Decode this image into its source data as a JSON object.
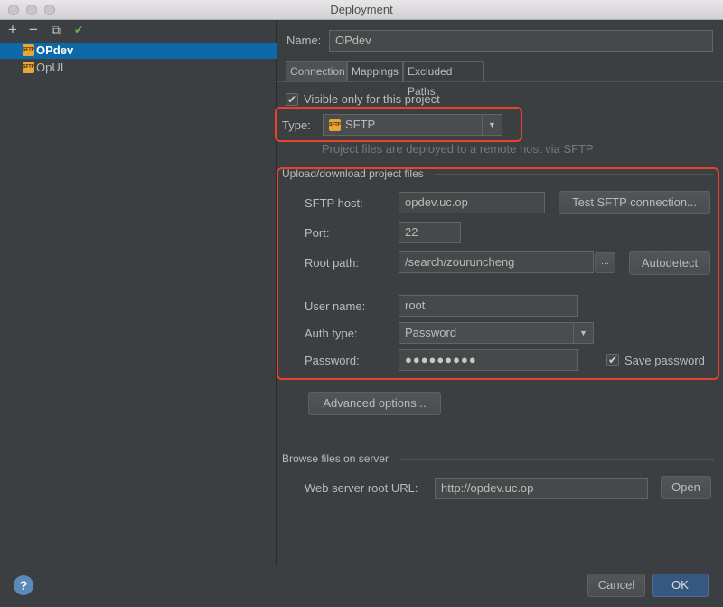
{
  "window": {
    "title": "Deployment"
  },
  "toolbar": {
    "add": "+",
    "remove": "−",
    "copy": "⧉",
    "default": "✔"
  },
  "servers": [
    {
      "name": "OPdev",
      "selected": true,
      "icon": "sftp-icon",
      "icon_text": "SFTP"
    },
    {
      "name": "OpUI",
      "selected": false,
      "icon": "sftp-icon",
      "icon_text": "SFTP"
    }
  ],
  "form": {
    "name_label": "Name:",
    "name_value": "OPdev",
    "tabs": [
      "Connection",
      "Mappings",
      "Excluded Paths"
    ],
    "visible_only": "Visible only for this project",
    "type_label": "Type:",
    "type_value": "SFTP",
    "type_hint": "Project files are deployed to a remote host via SFTP",
    "upload_section": "Upload/download project files",
    "sftp_host_label": "SFTP host:",
    "sftp_host_value": "opdev.uc.op",
    "test_button": "Test SFTP connection...",
    "port_label": "Port:",
    "port_value": "22",
    "root_path_label": "Root path:",
    "root_path_value": "/search/zouruncheng",
    "browse_button": "...",
    "autodetect_button": "Autodetect",
    "user_name_label": "User name:",
    "user_name_value": "root",
    "auth_type_label": "Auth type:",
    "auth_type_value": "Password",
    "password_label": "Password:",
    "password_value": "●●●●●●●●●",
    "save_password": "Save password",
    "advanced_button": "Advanced options...",
    "browse_section": "Browse files on server",
    "web_root_label": "Web server root URL:",
    "web_root_value": "http://opdev.uc.op",
    "open_button": "Open"
  },
  "footer": {
    "help": "?",
    "cancel": "Cancel",
    "ok": "OK"
  },
  "colors": {
    "accent": "#0d6aa8",
    "highlight": "#e8422d",
    "background": "#3c3f41"
  }
}
